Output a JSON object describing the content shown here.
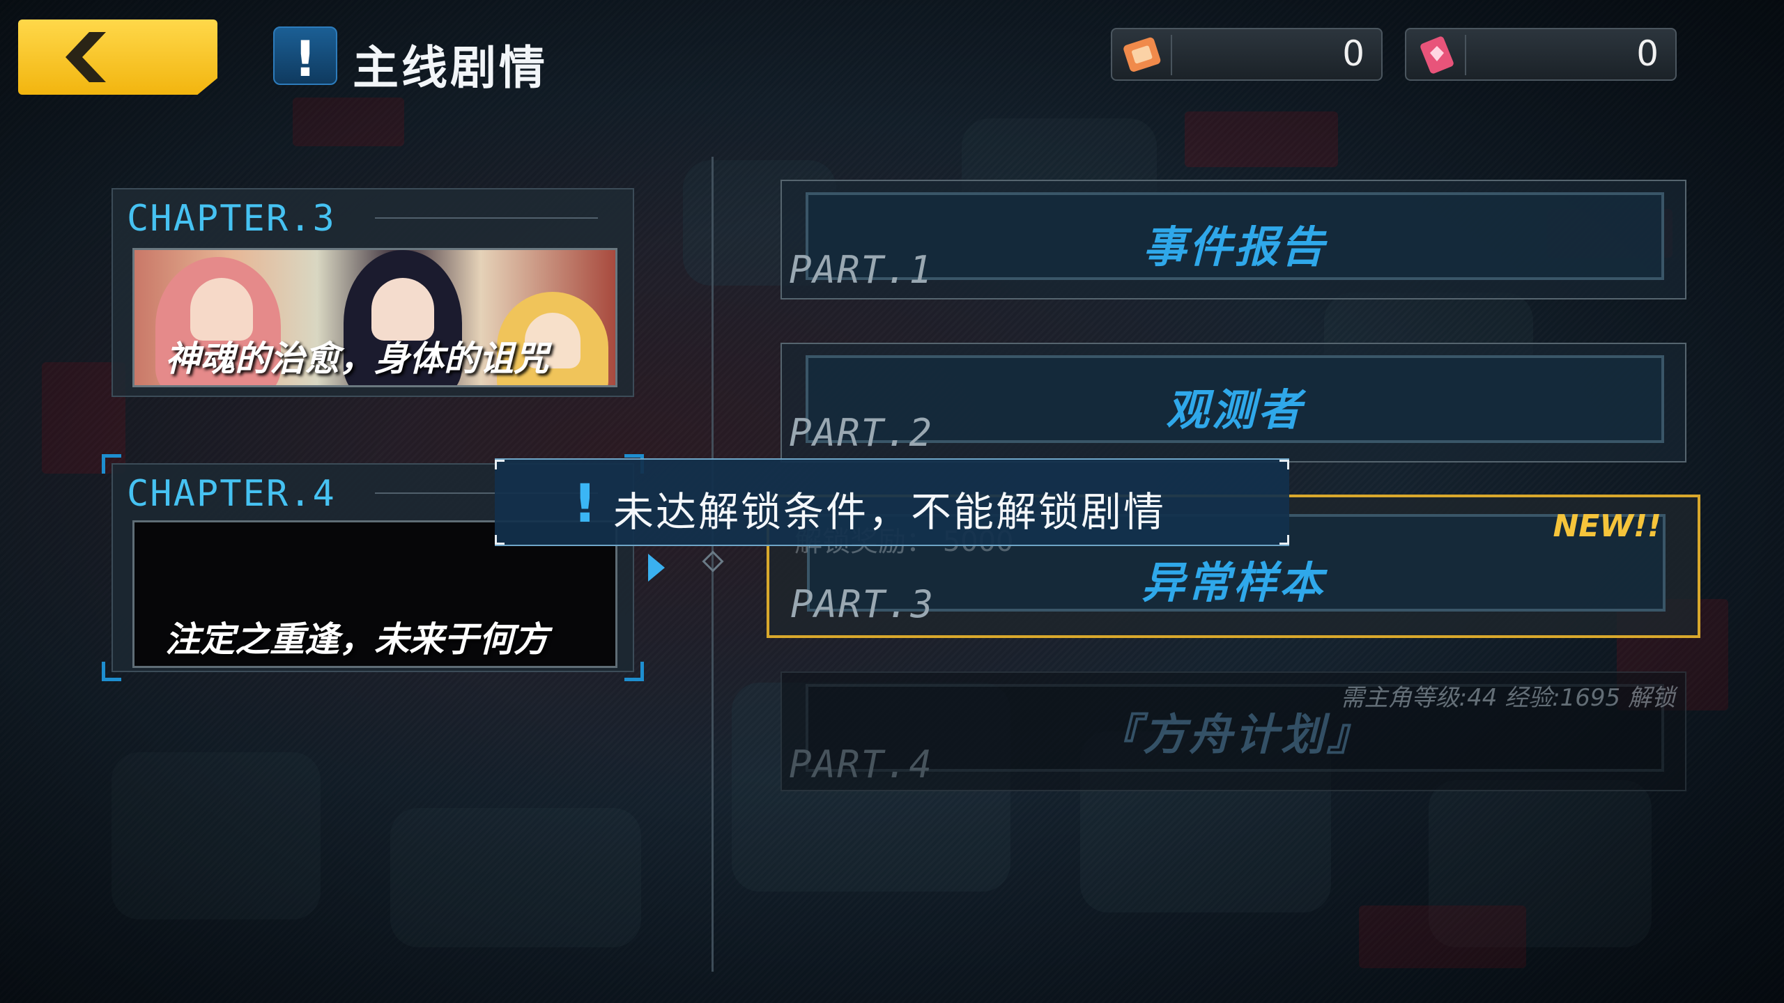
{
  "header": {
    "back_icon": "chevron-left-icon",
    "title_icon": "exclamation-icon",
    "title": "主线剧情"
  },
  "currencies": [
    {
      "icon": "ticket-icon",
      "value": "0",
      "color": "#f08a4b"
    },
    {
      "icon": "gem-card-icon",
      "value": "0",
      "color": "#e8547a"
    }
  ],
  "chapters": [
    {
      "label": "CHAPTER.3",
      "subtitle": "神魂的治愈，身体的诅咒"
    },
    {
      "label": "CHAPTER.4",
      "subtitle": "注定之重逢，未来于何方"
    }
  ],
  "parts": [
    {
      "label": "PART.1",
      "name": "事件报告"
    },
    {
      "label": "PART.2",
      "name": "观测者"
    },
    {
      "label": "PART.3",
      "name": "异常样本",
      "badge": "NEW!!"
    },
    {
      "label": "PART.4",
      "name": "『方舟计划』",
      "requirement": "需主角等级:44 经验:1695 解锁"
    }
  ],
  "toast": {
    "icon": "exclamation-icon",
    "message": "未达解锁条件，不能解锁剧情"
  },
  "reward_hint": "解锁奖励：  5000",
  "colors": {
    "accent_blue": "#2fa8ea",
    "highlight_gold": "#d9a82c",
    "back_button": "#f2b50f"
  }
}
